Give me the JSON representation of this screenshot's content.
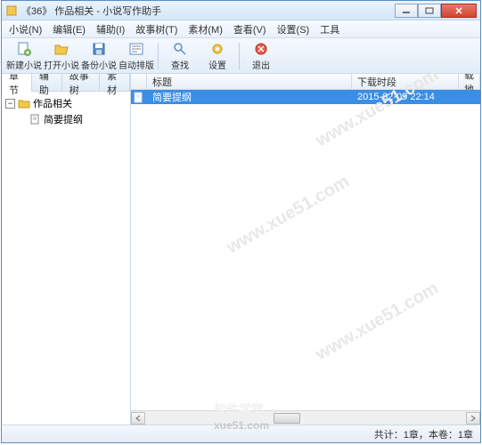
{
  "window": {
    "title": "《36》 作品相关 - 小说写作助手"
  },
  "menu": {
    "items": [
      "小说(N)",
      "编辑(E)",
      "辅助(I)",
      "故事树(T)",
      "素材(M)",
      "查看(V)",
      "设置(S)",
      "工具"
    ]
  },
  "toolbar": {
    "new_novel": "新建小说",
    "open_novel": "打开小说",
    "backup_novel": "备份小说",
    "auto_layout": "自动排版",
    "find": "查找",
    "settings": "设置",
    "exit": "退出"
  },
  "tabs": [
    "章节",
    "辅助",
    "故事树",
    "素材"
  ],
  "tree": {
    "root": "作品相关",
    "children": [
      "简要提纲"
    ]
  },
  "list": {
    "headers": {
      "title": "标题",
      "time": "下载时段",
      "addr": "下载地址"
    },
    "rows": [
      {
        "title": "简要提纲",
        "time": "2015-02-09 22:14",
        "addr": ""
      }
    ]
  },
  "status": "共计：1章，本卷：1章",
  "watermark": {
    "url": "www.xue51.com",
    "brand": "软件学堂",
    "site": "xue51.com"
  }
}
